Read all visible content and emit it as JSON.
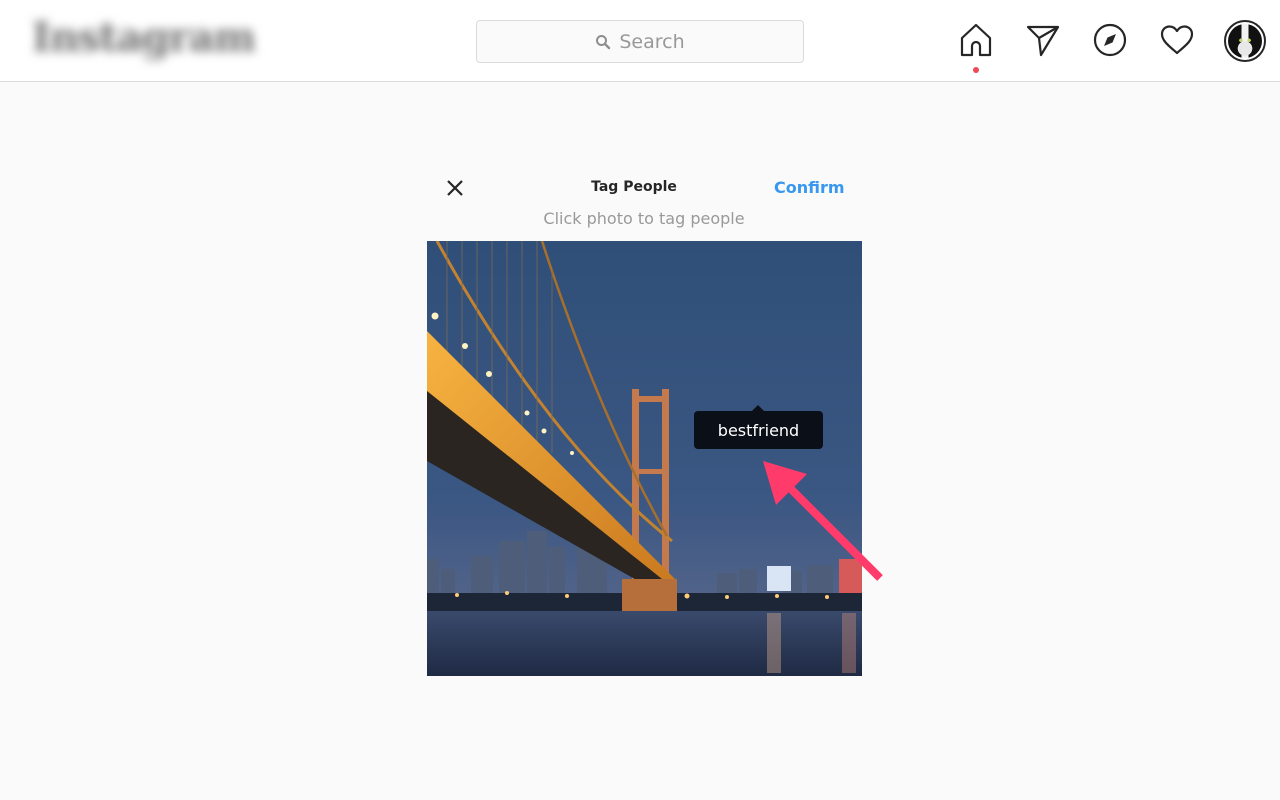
{
  "header": {
    "logo_text": "Instagram",
    "search": {
      "placeholder": "Search",
      "icon": "search-icon"
    },
    "nav": [
      {
        "name": "home",
        "icon": "home-icon",
        "active": true,
        "indicator_color": "#ed4956"
      },
      {
        "name": "direct",
        "icon": "paper-plane-icon"
      },
      {
        "name": "explore",
        "icon": "compass-icon"
      },
      {
        "name": "activity",
        "icon": "heart-icon"
      },
      {
        "name": "profile",
        "icon": "avatar"
      }
    ]
  },
  "dialog": {
    "close_icon": "close-icon",
    "title": "Tag People",
    "confirm_label": "Confirm",
    "confirm_color": "#3897f0",
    "hint": "Click photo to tag people",
    "photo_description": "Suspension bridge over river at dusk with city skyline",
    "tags": [
      {
        "username": "bestfriend"
      }
    ]
  },
  "annotation": {
    "arrow_color": "#ff3b6b",
    "points_to": "bestfriend tag"
  }
}
